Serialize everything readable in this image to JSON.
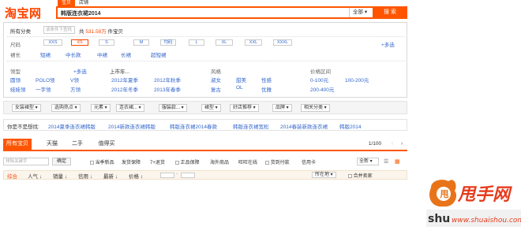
{
  "brand": {
    "logo_text": "淘宝网",
    "accent": "#ff5500"
  },
  "search": {
    "tabs": [
      "宝贝",
      "店铺"
    ],
    "query": "韩版连衣裙2014",
    "scope": "全部",
    "button": "搜 索"
  },
  "filter": {
    "category_label": "所有分类",
    "condition_placeholder": "该条件下查找",
    "count_prefix": "共",
    "count_value": "531.58万",
    "count_suffix": "件宝贝",
    "size_label": "尺码",
    "sizes": [
      "XXS",
      "XS",
      "S",
      "M",
      "均码",
      "L",
      "XL",
      "XXL",
      "XXXL"
    ],
    "more1": "+多选",
    "skirt_label": "裙长",
    "skirts": [
      "短裙",
      "中长款",
      "中裙",
      "长裙",
      "超短裙"
    ],
    "collar_label": "领型",
    "more2": "+多选",
    "collars_r1": [
      "圆领",
      "POLO领",
      "V领"
    ],
    "collars_r2": [
      "娃娃领",
      "一字领",
      "方领"
    ],
    "year_label": "上市年...",
    "years_r1": [
      "2012年夏季",
      "2012年秋季"
    ],
    "years_r2": [
      "2012年冬季",
      "2013年春季"
    ],
    "style_label": "风格",
    "styles_r1": [
      "淑女",
      "甜美",
      "性感"
    ],
    "styles_r2": [
      "复古",
      "OL",
      "优雅"
    ],
    "price_label": "价格区间",
    "prices_r1": [
      "0-100元",
      "100-200元"
    ],
    "prices_r2": [
      "200-400元"
    ]
  },
  "sortbar": {
    "items": [
      "女装裙型",
      "选购热点",
      "元素",
      "连衣裙...",
      "服装款...",
      "裙型",
      "好店推荐",
      "品牌",
      "相关分类"
    ]
  },
  "suggest": {
    "label": "你是不是想找:",
    "items": [
      "2014夏季连衣裙韩版",
      "2014新款连衣裙韩版",
      "韩版连衣裙2014春款",
      "韩版连衣裙宽松",
      "2014春装新款连衣裙",
      "韩版2014"
    ]
  },
  "result_tabs": {
    "tabs": [
      "所有宝贝",
      "天猫",
      "二手",
      "值得买"
    ],
    "page": "1/100"
  },
  "tools": {
    "search_placeholder": "排除关键字",
    "confirm": "确定",
    "checks": [
      "当季新品",
      "发货保障",
      "7+退货",
      "正品保障",
      "海外商品",
      "旺旺在线",
      "货到付款",
      "信用卡"
    ],
    "view_select": "全新"
  },
  "sorts": {
    "items": [
      "综合",
      "人气",
      "销量",
      "信用",
      "最新",
      "价格"
    ],
    "location": "所在地",
    "merge": "合并卖家"
  },
  "watermark": {
    "text": "甩手网",
    "sub": "shu",
    "domain": "www.shuaishou.com"
  }
}
